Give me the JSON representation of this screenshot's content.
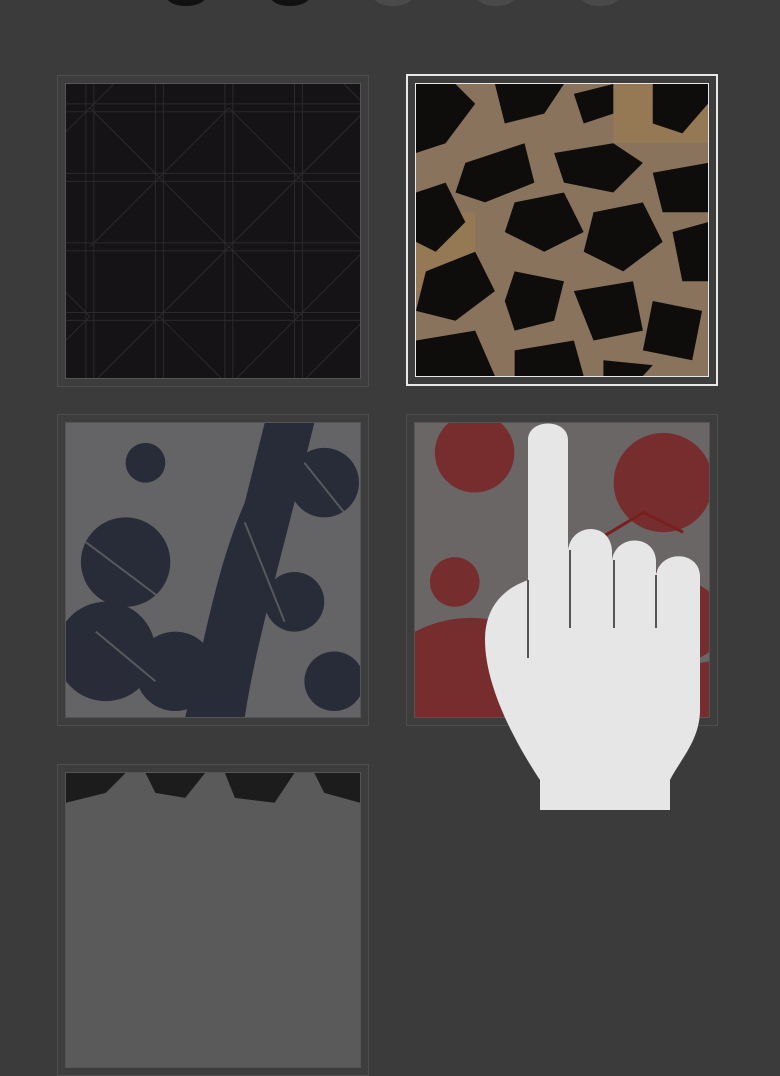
{
  "pager": {
    "dots": [
      {
        "state": "active"
      },
      {
        "state": "active"
      },
      {
        "state": "inactive"
      },
      {
        "state": "inactive"
      },
      {
        "state": "inactive"
      }
    ]
  },
  "patterns": [
    {
      "name": "black-lattice-pattern",
      "selected": false
    },
    {
      "name": "leopard-print-pattern",
      "selected": true
    },
    {
      "name": "navy-tree-toile-pattern",
      "selected": false
    },
    {
      "name": "red-tree-toile-pattern",
      "selected": false
    },
    {
      "name": "monochrome-brush-pattern",
      "selected": false
    }
  ],
  "overlay": {
    "icon": "tap-hand-icon"
  },
  "colors": {
    "background": "#3b3b3b",
    "selected_border": "#e8e8e8",
    "lattice": "#151315",
    "leopard_base": "#8a735c",
    "leopard_spot": "#0f0d0c",
    "navy_toile": "#1e2230",
    "red_toile": "#7a1f1f"
  }
}
